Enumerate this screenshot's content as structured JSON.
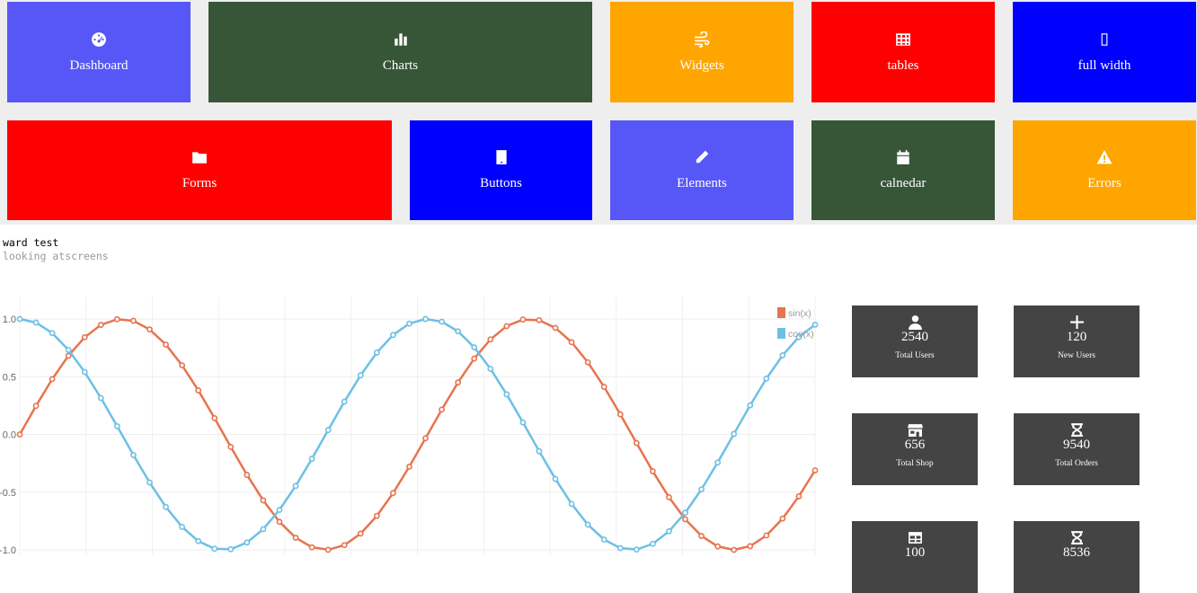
{
  "tiles": [
    {
      "label": "Dashboard",
      "icon": "dashboard-gauge-icon",
      "color": "#5757f7"
    },
    {
      "label": "Charts",
      "icon": "bar-chart-icon",
      "color": "#375537"
    },
    {
      "label": "Widgets",
      "icon": "wind-icon",
      "color": "#ffa500"
    },
    {
      "label": "tables",
      "icon": "table-grid-icon",
      "color": "#ff0000"
    },
    {
      "label": "full width",
      "icon": "placeholder-box-icon",
      "color": "#0000ff"
    },
    {
      "label": "Forms",
      "icon": "folder-icon",
      "color": "#ff0000"
    },
    {
      "label": "Buttons",
      "icon": "tablet-icon",
      "color": "#0000ff"
    },
    {
      "label": "Elements",
      "icon": "pencil-icon",
      "color": "#5757f7"
    },
    {
      "label": "calnedar",
      "icon": "calendar-icon",
      "color": "#375537"
    },
    {
      "label": "Errors",
      "icon": "warning-icon",
      "color": "#ffa500"
    }
  ],
  "note": {
    "title": "ward test",
    "subtitle": "looking atscreens"
  },
  "chart_data": {
    "type": "line",
    "x_range": [
      0,
      12.25
    ],
    "ylim": [
      -1,
      1
    ],
    "yticks": [
      "1.0",
      "0.5",
      "0.0",
      "-0.5",
      "-1.0"
    ],
    "grid": true,
    "legend_position": "top-right",
    "series": [
      {
        "name": "sin(x)",
        "function": "sin",
        "color": "#e8734f",
        "x_start": 0,
        "x_step": 0.25,
        "points": 50
      },
      {
        "name": "cos(x)",
        "function": "cos",
        "color": "#6cc0e5",
        "x_start": 0,
        "x_step": 0.25,
        "points": 50
      }
    ]
  },
  "stats": [
    {
      "icon": "user-icon",
      "value": "2540",
      "label": "Total Users"
    },
    {
      "icon": "plus-icon",
      "value": "120",
      "label": "New Users"
    },
    {
      "icon": "shop-icon",
      "value": "656",
      "label": "Total Shop"
    },
    {
      "icon": "hourglass-icon",
      "value": "9540",
      "label": "Total Orders"
    },
    {
      "icon": "table-icon",
      "value": "100",
      "label": ""
    },
    {
      "icon": "hourglass-icon",
      "value": "8536",
      "label": ""
    }
  ]
}
